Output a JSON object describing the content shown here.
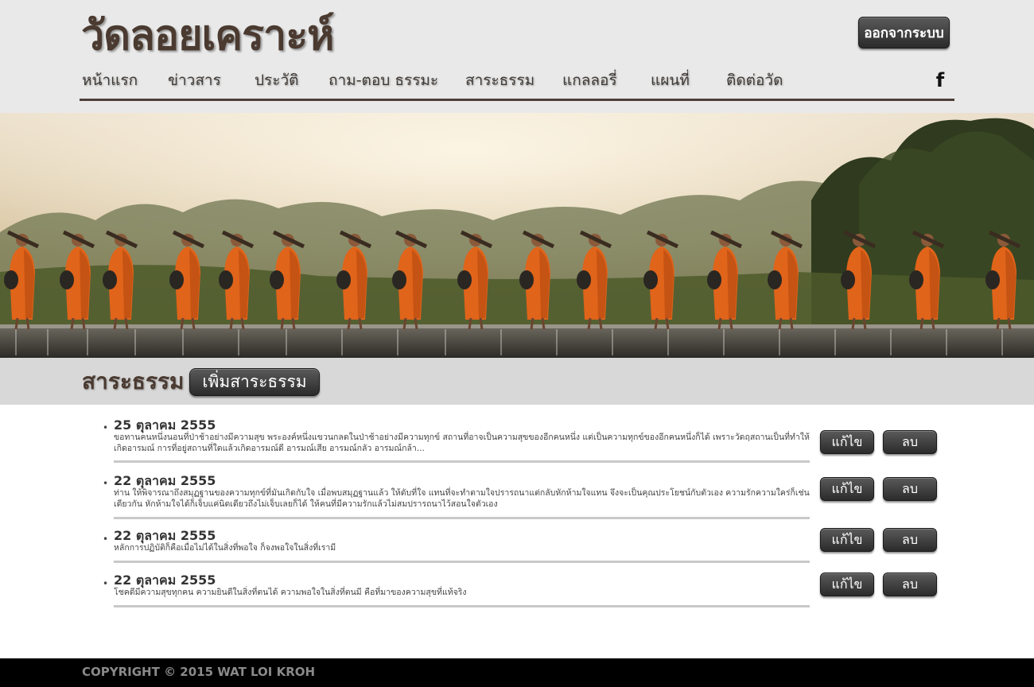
{
  "header": {
    "site_title": "วัดลอยเคราะห์",
    "logout_label": "ออกจากระบบ",
    "nav": [
      {
        "label": "หน้าแรก"
      },
      {
        "label": "ข่าวสาร"
      },
      {
        "label": "ประวัติ"
      },
      {
        "label": "ถาม-ตอบ ธรรมะ"
      },
      {
        "label": "สาระธรรม"
      },
      {
        "label": "แกลลอรี่"
      },
      {
        "label": "แผนที่"
      },
      {
        "label": "ติดต่อวัด"
      }
    ],
    "facebook_icon": "facebook-icon",
    "facebook_glyph": "f"
  },
  "hero": {
    "image": "monks-walking-across-weir-photo",
    "robe_color": "#e0641a"
  },
  "section": {
    "title": "สาระธรรม",
    "add_label": "เพิ่มสาระธรรม"
  },
  "entries": [
    {
      "date": "25 ตุลาคม 2555",
      "text": "ขอทานคนหนึ่งนอนที่ป่าช้าอย่างมีความสุข พระองค์หนึ่งแขวนกลดในป่าช้าอย่างมีความทุกข์ สถานที่อาจเป็นความสุขของอีกคนหนึ่ง แต่เป็นความทุกข์ของอีกคนหนึ่งก็ได้ เพราะวัดฤสถานเป็นที่ทำให้เกิดอารมณ์ การที่อยู่สถานที่ใดแล้วเกิดอารมณ์ดี อารมณ์เสีย อารมณ์กลัว อารมณ์กล้า...",
      "edit_label": "แก้ไข",
      "delete_label": "ลบ"
    },
    {
      "date": "22 ตุลาคม 2555",
      "text": "ท่าน ให้พิจารณาถึงสมุฏฐานของความทุกข์ที่มันเกิดกับใจ เมื่อพบสมุฏฐานแล้ว ให้ดับที่ใจ แทนที่จะทำตามใจปรารถนาแต่กลับหักห้ามใจแทน จึงจะเป็นคุณประโยชน์กับตัวเอง ความรักความใคร่ก็เช่นเดียวกัน หักห้ามใจได้ก็เจ็บแค่นิดเดียวถึงไม่เจ็บเลยก็ได้ ให้คนที่มีความรักแล้วไม่สมปรารถนาไว้สอนใจตัวเอง",
      "edit_label": "แก้ไข",
      "delete_label": "ลบ"
    },
    {
      "date": "22 ตุลาคม 2555",
      "text": "หลักการปฏิบัติก็คือเมื่อไม่ได้ในสิ่งที่พอใจ ก็จงพอใจในสิ่งที่เรามี",
      "edit_label": "แก้ไข",
      "delete_label": "ลบ"
    },
    {
      "date": "22 ตุลาคม 2555",
      "text": "โชคดีมีความสุขทุกคน ความยินดีในสิ่งที่ตนได้ ความพอใจในสิ่งที่ตนมี คือที่มาของความสุขที่แท้จริง",
      "edit_label": "แก้ไข",
      "delete_label": "ลบ"
    }
  ],
  "footer": {
    "copyright": "COPYRIGHT © 2015 WAT LOI KROH"
  },
  "colors": {
    "header_bg": "#e9e9e9",
    "title_brown": "#4a3a30",
    "section_bar_bg": "#d8d8d8",
    "footer_bg": "#000000",
    "footer_text": "#8a8a8a"
  }
}
